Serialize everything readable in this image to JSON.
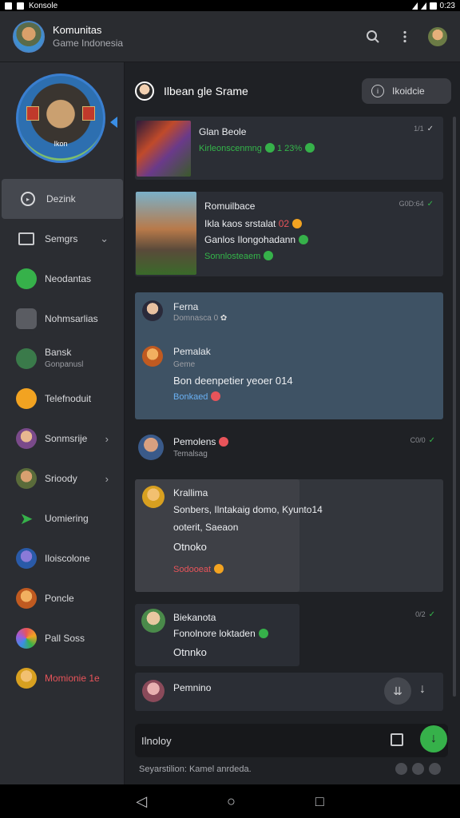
{
  "status_bar": {
    "left_text": "Konsole",
    "time": "0:23"
  },
  "header": {
    "title": "Komunitas",
    "subtitle": "Game Indonesia",
    "search_icon": "search-icon",
    "menu_icon": "more-vert-icon"
  },
  "sidebar": {
    "profile_label": "Ikon",
    "items": [
      {
        "label": "Dezink",
        "icon": "play-circle-icon",
        "active": true
      },
      {
        "label": "Semgrs",
        "icon": "message-square-icon",
        "chevron": "⌄"
      },
      {
        "label": "Neodantas",
        "icon": "chat-bubble-icon",
        "color": "#36b14a"
      },
      {
        "label": "Nohmsarlias",
        "icon": "controller-icon",
        "color": "#6a6c72"
      },
      {
        "label": "Bansk",
        "sub": "Gonpanusl",
        "icon": "leaf-icon",
        "color": "#3a7a4a"
      },
      {
        "label": "Telefnoduit",
        "icon": "badge-icon",
        "color": "#f2a321"
      },
      {
        "label": "Sonmsrije",
        "icon": "avatar-icon",
        "chevron": "›"
      },
      {
        "label": "Srioody",
        "icon": "avatar-icon",
        "chevron": "›"
      },
      {
        "label": "Uomiering",
        "icon": "bird-icon",
        "color": "#36b14a"
      },
      {
        "label": "Iloiscolone",
        "icon": "avatar-icon"
      },
      {
        "label": "Poncle",
        "icon": "avatar-icon"
      },
      {
        "label": "Pall Soss",
        "icon": "avatar-icon"
      },
      {
        "label": "Momionie 1e",
        "icon": "avatar-icon",
        "alert": true
      }
    ]
  },
  "chat": {
    "title": "Ilbean gle Srame",
    "action_button": "Ikoidcie"
  },
  "messages": [
    {
      "type": "image",
      "title": "Glan Beole",
      "line1": "Kirleonscenmng",
      "line1b": "1 23%",
      "time": "1/1"
    },
    {
      "type": "image",
      "title": "Romuilbace",
      "line1": "Ikla kaos srstalat",
      "line1b": "02",
      "line2": "Ganlos Ilongohadann",
      "line3": "Sonnlosteaem",
      "time": "G0D:64"
    },
    {
      "type": "thread",
      "users": [
        {
          "name": "Ferna",
          "status": "Domnasca 0"
        },
        {
          "name": "Pemalak",
          "status": "Geme",
          "text": "Bon deenpetier yeoer 014",
          "tag": "Bonkaed"
        }
      ]
    },
    {
      "type": "single",
      "name": "Pemolens",
      "status": "Temalsag",
      "time": "C0/0"
    },
    {
      "type": "highlight",
      "name": "Krallima",
      "line1": "Sonbers, Ilntakaig domo, Kyunto14",
      "line2": "ooterit, Saeaon",
      "line3": "Otnoko",
      "tag": "Sodooeat"
    },
    {
      "type": "single",
      "name": "Biekanota",
      "line1": "Fonolnore loktaden",
      "line2": "Otnnko",
      "time": "0/2"
    },
    {
      "type": "single",
      "name": "Pemnino"
    }
  ],
  "composer": {
    "value": "Ilnoloy",
    "hint": "Seyarstilion: Kamel anrdeda."
  },
  "colors": {
    "accent_green": "#36b14a",
    "accent_blue": "#3a8ee6",
    "alert_red": "#e8545a",
    "card_blue": "#3e5264"
  }
}
